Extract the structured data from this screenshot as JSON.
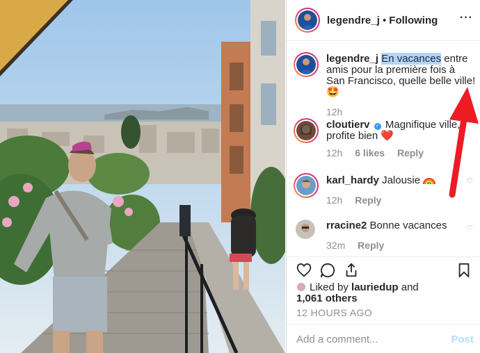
{
  "header": {
    "username": "legendre_j",
    "separator": "•",
    "follow_state": "Following",
    "more_label": "···"
  },
  "caption": {
    "username": "legendre_j",
    "text_selected": "En vacances",
    "text_rest": "entre amis pour la première fois à San Francisco, quelle belle ville! 🤩",
    "time": "12h"
  },
  "comments": [
    {
      "username": "cloutierv",
      "verified": true,
      "text": "Magnifique ville, profite bien",
      "emoji": "❤️",
      "time": "12h",
      "likes": "6 likes",
      "reply": "Reply"
    },
    {
      "username": "karl_hardy",
      "text": "Jalousie",
      "time": "12h",
      "reply": "Reply"
    },
    {
      "username": "rracine2",
      "text": "Bonne vacances",
      "time": "32m",
      "reply": "Reply"
    }
  ],
  "likes": {
    "prefix": "Liked by",
    "user": "lauriedup",
    "and": "and",
    "others": "1,061 others"
  },
  "timestamp": "12 HOURS AGO",
  "add_comment": {
    "placeholder": "Add a comment...",
    "post_label": "Post"
  },
  "colors": {
    "accent": "#3897f0",
    "post_disabled": "#b2dffc",
    "muted": "#8e8e8e",
    "annotation_arrow": "#ed1c24",
    "selection": "#b3d4fc"
  },
  "icons": [
    "heart-icon",
    "comment-icon",
    "share-icon",
    "bookmark-icon",
    "more-icon",
    "verified-icon",
    "small-heart-icon"
  ]
}
